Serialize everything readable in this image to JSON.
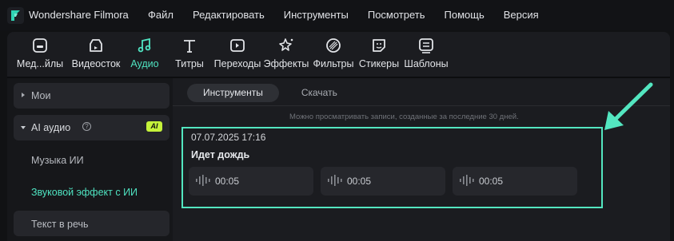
{
  "app": {
    "name": "Wondershare Filmora"
  },
  "menu": [
    "Файл",
    "Редактировать",
    "Инструменты",
    "Посмотреть",
    "Помощь",
    "Версия"
  ],
  "tools": [
    {
      "label": "Мед...йлы",
      "icon": "media-icon"
    },
    {
      "label": "Видеосток",
      "icon": "stock-video-icon"
    },
    {
      "label": "Аудио",
      "icon": "music-note-icon",
      "active": true
    },
    {
      "label": "Титры",
      "icon": "title-text-icon"
    },
    {
      "label": "Переходы",
      "icon": "transition-icon"
    },
    {
      "label": "Эффекты",
      "icon": "effects-sparkle-icon"
    },
    {
      "label": "Фильтры",
      "icon": "filter-icon"
    },
    {
      "label": "Стикеры",
      "icon": "sticker-icon"
    },
    {
      "label": "Шаблоны",
      "icon": "template-icon"
    }
  ],
  "sidebar": {
    "mine": "Мои",
    "ai_audio": "AI аудио",
    "ai_badge": "AI",
    "ai_music": "Музыка ИИ",
    "ai_sfx": "Звуковой эффект с ИИ",
    "tts": "Текст в речь"
  },
  "tabs": [
    "Инструменты",
    "Скачать"
  ],
  "notice": "Можно просматривать записи, созданные за последние 30 дней.",
  "entry": {
    "date": "07.07.2025 17:16",
    "title": "Идет дождь",
    "clips": [
      "00:05",
      "00:05",
      "00:05"
    ]
  },
  "colors": {
    "accent": "#4fe3c1",
    "highlight_border": "#53e6c0",
    "ai_badge": "#c5f23a"
  }
}
